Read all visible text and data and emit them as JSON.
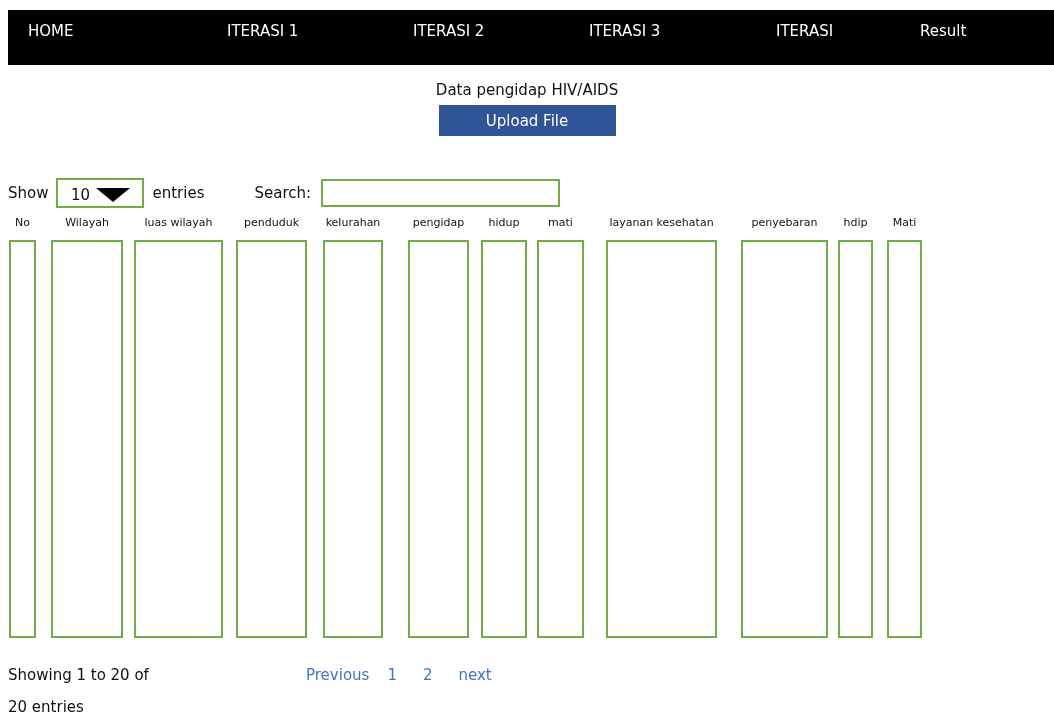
{
  "nav": {
    "items": [
      "HOME",
      "ITERASI 1",
      "ITERASI 2",
      "ITERASI 3",
      "ITERASI",
      "Result"
    ]
  },
  "title": "Data pengidap HIV/AIDS",
  "upload_button": "Upload File",
  "length_control": {
    "label_before": "Show",
    "value": "10",
    "label_after": "entries"
  },
  "search": {
    "label": "Search:"
  },
  "table": {
    "columns": [
      "No",
      "Wilayah",
      "luas wilayah",
      "penduduk",
      "kelurahan",
      "pengidap",
      "hidup",
      "mati",
      "layanan kesehatan",
      "penyebaran",
      "hdip",
      "Mati"
    ]
  },
  "info": [
    "Showing 1 to 20 of",
    "20 entries"
  ],
  "pagination": [
    "Previous",
    "1",
    "2",
    "next"
  ]
}
